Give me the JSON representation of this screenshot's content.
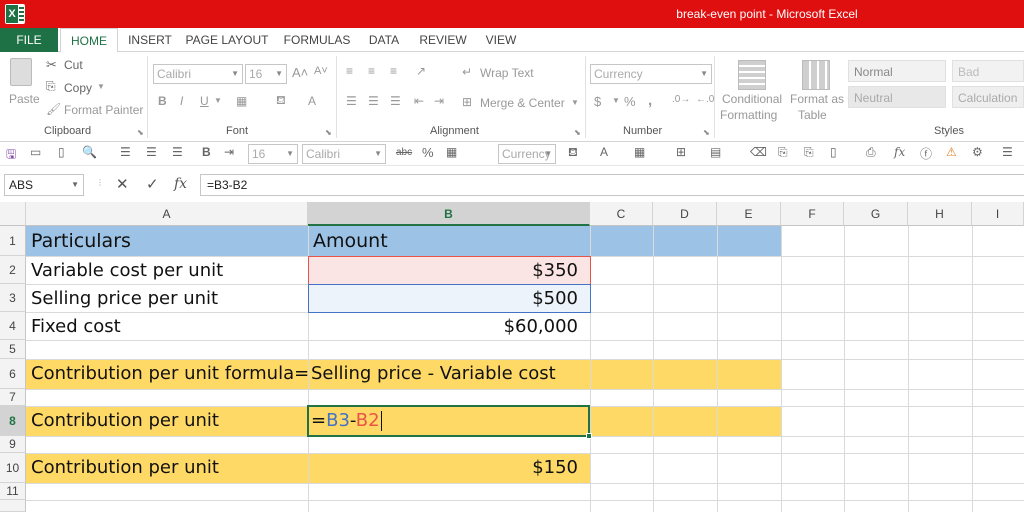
{
  "window": {
    "title": "break-even point -  Microsoft Excel",
    "app_icon": "excel-icon"
  },
  "tabs": [
    "FILE",
    "HOME",
    "INSERT",
    "PAGE LAYOUT",
    "FORMULAS",
    "DATA",
    "REVIEW",
    "VIEW"
  ],
  "ribbon": {
    "clipboard": {
      "label": "Clipboard",
      "paste": "Paste",
      "cut": "Cut",
      "copy": "Copy",
      "format_painter": "Format Painter"
    },
    "font": {
      "label": "Font",
      "name": "Calibri",
      "size": "16",
      "bold": "B",
      "italic": "I",
      "underline": "U",
      "font_color": "A"
    },
    "alignment": {
      "label": "Alignment",
      "wrap_text": "Wrap Text",
      "merge_center": "Merge & Center"
    },
    "number": {
      "label": "Number",
      "format": "Currency",
      "currency": "$",
      "percent": "%",
      "comma": ","
    },
    "styles": {
      "label": "Styles",
      "conditional": "Conditional",
      "conditional2": "Formatting",
      "format_as": "Format as",
      "format_as2": "Table",
      "normal": "Normal",
      "bad": "Bad",
      "neutral": "Neutral",
      "calculation": "Calculation"
    }
  },
  "qat": {
    "bold": "B",
    "size": "16",
    "font": "Calibri",
    "abc": "abc",
    "percent": "%",
    "format": "Currency",
    "font_color": "A",
    "fx": "fx"
  },
  "formula_bar": {
    "name_box": "ABS",
    "fx": "fx",
    "formula": "=B3-B2"
  },
  "columns": [
    "A",
    "B",
    "C",
    "D",
    "E",
    "F",
    "G",
    "H",
    "I"
  ],
  "rows": [
    "1",
    "2",
    "3",
    "4",
    "5",
    "6",
    "7",
    "8",
    "9",
    "10",
    "11"
  ],
  "cells": {
    "a1": "Particulars",
    "b1": "Amount",
    "a2": "Variable cost per unit",
    "b2": "$350",
    "a3": "Selling price per unit",
    "b3": "$500",
    "a4": "Fixed cost",
    "b4": "$60,000",
    "a6": "Contribution per unit formula=",
    "b6": "Selling price - Variable cost",
    "a8": "Contribution per unit",
    "b8_eq": "=",
    "b8_ref1": "B3",
    "b8_minus": "-",
    "b8_ref2": "B2",
    "a10": "Contribution per unit",
    "b10": "$150"
  },
  "colors": {
    "title_bar": "#e00f0f",
    "file_tab": "#1e7145",
    "header_fill": "#9cc2e5",
    "highlight_fill": "#ffd966",
    "ref_blue": "#4472c4",
    "ref_red": "#e8534a",
    "active_cell": "#217346"
  }
}
